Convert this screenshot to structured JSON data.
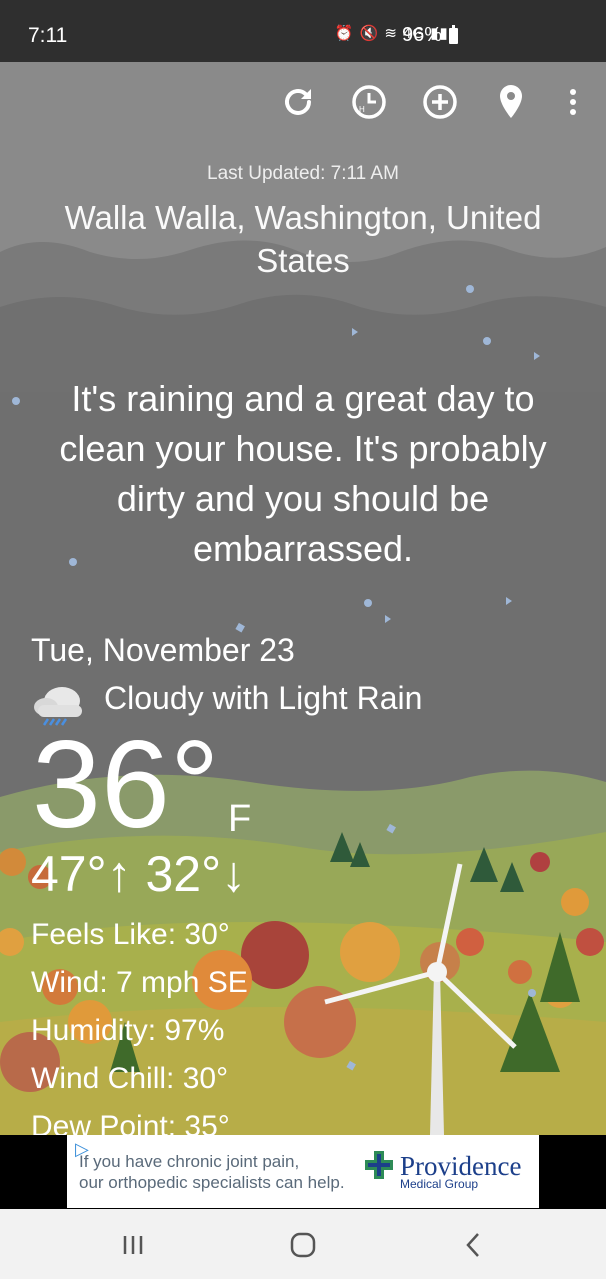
{
  "status_bar": {
    "time": "7:11",
    "indicators": "⏰ 🔇 ≋ 4G ▮▮▮",
    "battery": "96%"
  },
  "toolbar": {
    "icons": [
      "refresh-icon",
      "history-icon",
      "add-location-icon",
      "location-pin-icon",
      "more-vert-icon"
    ]
  },
  "weather": {
    "last_updated": "Last Updated: 7:11 AM",
    "location": "Walla Walla, Washington, United States",
    "quote": "It's raining and a great day to clean your house. It's probably dirty and you should be embarrassed.",
    "date": "Tue, November 23",
    "condition": "Cloudy with Light Rain",
    "temperature": "36°",
    "unit": "F",
    "high_low": "47°↑ 32°↓",
    "details": [
      {
        "label": "Feels Like:",
        "value": "30°"
      },
      {
        "label": "Wind:",
        "value": "7 mph SE"
      },
      {
        "label": "Humidity:",
        "value": "97%"
      },
      {
        "label": "Wind Chill:",
        "value": "30°"
      },
      {
        "label": "Dew Point:",
        "value": "35°"
      }
    ]
  },
  "ad": {
    "line1": "If you have chronic joint pain,",
    "line2": "our orthopedic specialists can help.",
    "brand": "Providence",
    "sub": "Medical Group"
  },
  "colors": {
    "sky": "#6d6d6d",
    "status_bar": "#2f2f2f",
    "nav_bar": "#f2f2f2",
    "brand_blue": "#1c3f8a"
  }
}
